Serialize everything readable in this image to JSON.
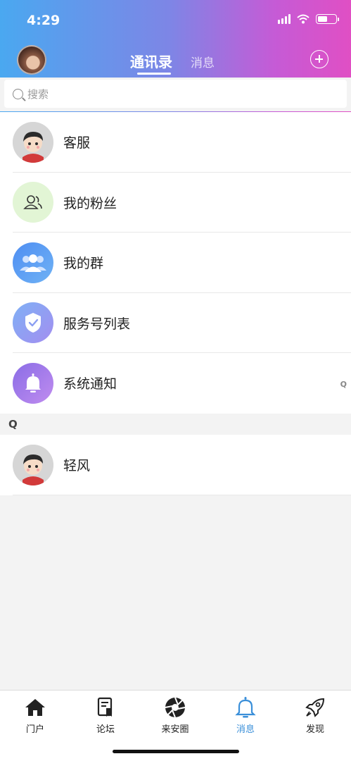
{
  "status_bar": {
    "time": "4:29"
  },
  "header": {
    "tabs": [
      {
        "label": "通讯录",
        "active": true
      },
      {
        "label": "消息",
        "active": false
      }
    ]
  },
  "search": {
    "placeholder": "搜索"
  },
  "list": [
    {
      "label": "客服",
      "icon": "cartoon-avatar"
    },
    {
      "label": "我的粉丝",
      "icon": "fans-icon",
      "color": "#e2f5d5"
    },
    {
      "label": "我的群",
      "icon": "group-icon",
      "color": "#5b9df0"
    },
    {
      "label": "服务号列表",
      "icon": "shield-icon",
      "color": "#8fa2f2"
    },
    {
      "label": "系统通知",
      "icon": "bell-icon",
      "color": "#9b78e6"
    }
  ],
  "index_letter": "Q",
  "section": {
    "header": "Q",
    "contacts": [
      {
        "label": "轻风",
        "icon": "cartoon-avatar"
      }
    ]
  },
  "tabbar": [
    {
      "label": "门户",
      "icon": "home-icon"
    },
    {
      "label": "论坛",
      "icon": "forum-icon"
    },
    {
      "label": "来安圈",
      "icon": "aperture-icon"
    },
    {
      "label": "消息",
      "icon": "bell-icon",
      "active": true
    },
    {
      "label": "发现",
      "icon": "rocket-icon"
    }
  ],
  "colors": {
    "accent": "#3a8fd9"
  }
}
